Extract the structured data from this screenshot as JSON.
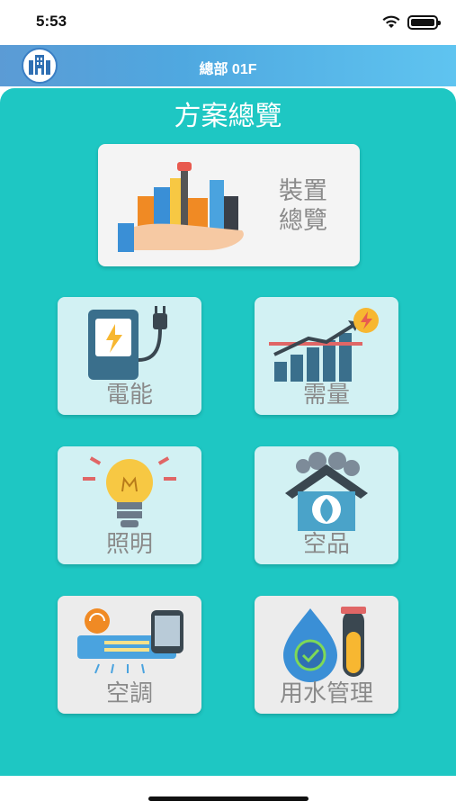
{
  "status": {
    "time": "5:53"
  },
  "header": {
    "title": "總部 01F",
    "logo_icon": "building-icon"
  },
  "panel": {
    "title": "方案總覽"
  },
  "tiles": {
    "overview": {
      "label_line1": "裝置",
      "label_line2": "總覽",
      "icon": "city-in-hand-icon"
    },
    "power": {
      "label": "電能",
      "icon": "ev-charger-icon"
    },
    "demand": {
      "label": "需量",
      "icon": "growth-chart-icon"
    },
    "lighting": {
      "label": "照明",
      "icon": "light-bulb-icon"
    },
    "air_quality": {
      "label": "空品",
      "icon": "leaf-house-icon"
    },
    "hvac": {
      "label": "空調",
      "icon": "air-conditioner-icon"
    },
    "water": {
      "label": "用水管理",
      "icon": "water-drop-icon"
    }
  },
  "colors": {
    "accent": "#1ec7c3",
    "header_start": "#5b9bd5",
    "header_end": "#5fc4f0",
    "tile_light": "#d2f1f3"
  }
}
